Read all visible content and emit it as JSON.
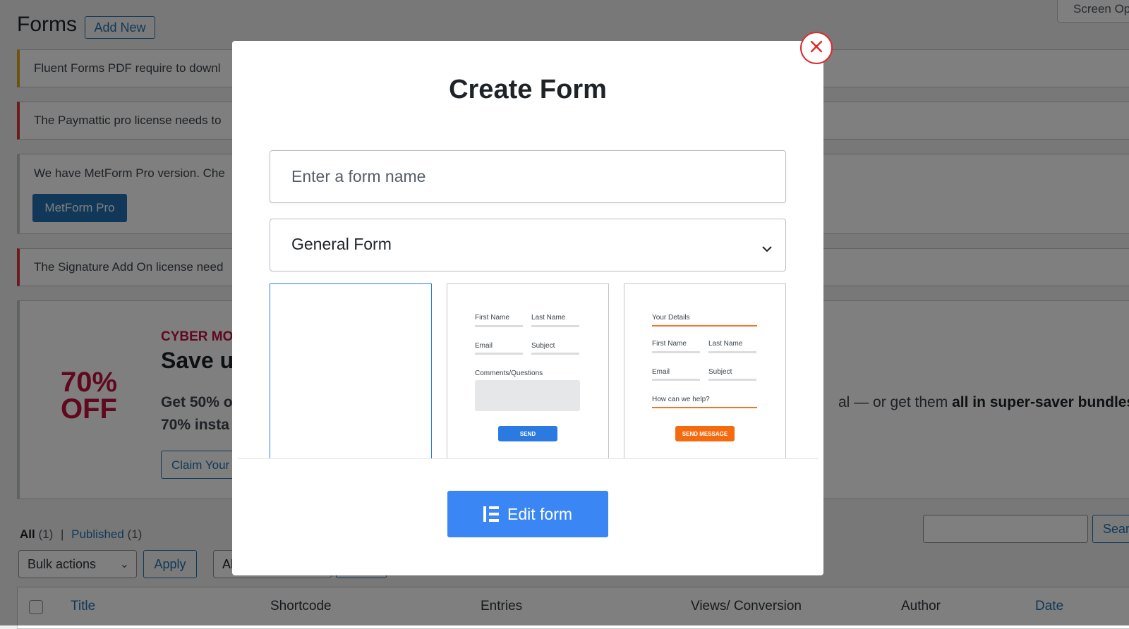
{
  "page": {
    "title": "Forms",
    "add_new_label": "Add New",
    "screen_options_label": "Screen Op"
  },
  "notices": [
    {
      "text": "Fluent Forms PDF require to downl"
    },
    {
      "text": "The Paymattic pro license needs to"
    },
    {
      "text": "We have MetForm Pro version. Che",
      "button_label": "MetForm Pro"
    },
    {
      "text": "The Signature Add On license need"
    }
  ],
  "promo": {
    "badge_line1": "70%",
    "badge_line2": "OFF",
    "eyebrow": "CYBER MO",
    "headline": "Save up",
    "body_line1": "Get 50% o",
    "body_line2": "70% insta",
    "cta_label": "Claim Your",
    "tail_text": "al — or get them ",
    "tail_bold": "all in super-saver bundles t"
  },
  "filters": {
    "all_label": "All",
    "all_count": "(1)",
    "separator": "|",
    "published_label": "Published",
    "published_count": "(1)"
  },
  "toolbar": {
    "bulk_actions": "Bulk actions",
    "apply_label": "Apply",
    "date_filter": "Al",
    "search_label": "Sear"
  },
  "table": {
    "columns": [
      "Title",
      "Shortcode",
      "Entries",
      "Views/ Conversion",
      "Author",
      "Date"
    ]
  },
  "modal": {
    "title": "Create Form",
    "name_placeholder": "Enter a form name",
    "form_type": "General Form",
    "templates": [
      {
        "name": "blank"
      },
      {
        "labels": [
          "First Name",
          "Last Name",
          "Email",
          "Subject",
          "Comments/Questions"
        ],
        "button": "SEND"
      },
      {
        "labels": [
          "Your Details",
          "First Name",
          "Last Name",
          "Email",
          "Subject",
          "How can we help?"
        ],
        "button": "SEND MESSAGE"
      }
    ],
    "edit_button_label": "Edit form"
  },
  "colors": {
    "primary_button": "#3a86f5",
    "close_ring": "#e0282b",
    "promo_accent": "#c0133d",
    "wp_link": "#2271b1",
    "template_orange": "#f46b0f"
  }
}
